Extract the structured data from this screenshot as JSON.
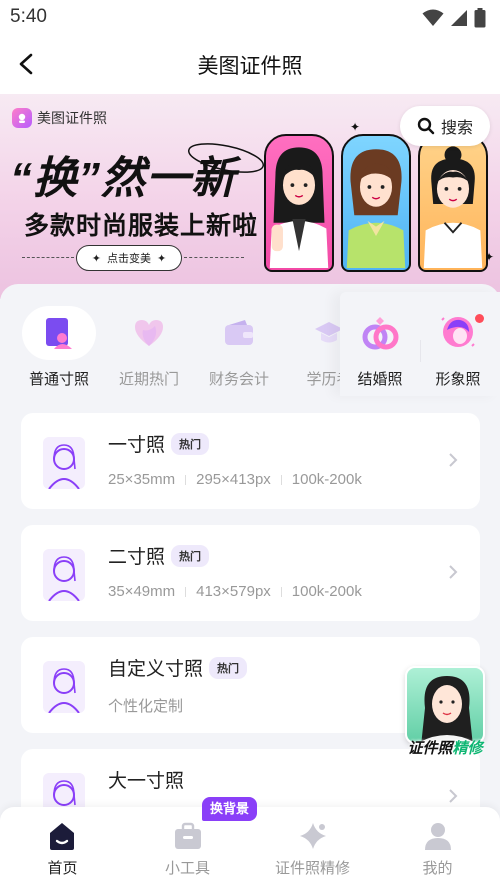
{
  "status_bar": {
    "time": "5:40"
  },
  "nav": {
    "title": "美图证件照"
  },
  "banner": {
    "brand": "美图证件照",
    "headline": "“换”然一新",
    "subheadline": "多款时尚服装上新啦",
    "cta": "点击变美"
  },
  "search": {
    "label": "搜索"
  },
  "categories": [
    {
      "label": "普通寸照",
      "icon": "portrait-card-icon",
      "active": true
    },
    {
      "label": "近期热门",
      "icon": "heart-icon",
      "active": false
    },
    {
      "label": "财务会计",
      "icon": "wallet-icon",
      "active": false
    },
    {
      "label": "学历考",
      "icon": "graduation-cap-icon",
      "active": false
    }
  ],
  "categories_right": [
    {
      "label": "结婚照",
      "icon": "rings-icon"
    },
    {
      "label": "形象照",
      "icon": "profile-icon"
    }
  ],
  "specs": [
    {
      "title": "一寸照",
      "badge": "热门",
      "size_mm": "25×35mm",
      "size_px": "295×413px",
      "file_size": "100k-200k"
    },
    {
      "title": "二寸照",
      "badge": "热门",
      "size_mm": "35×49mm",
      "size_px": "413×579px",
      "file_size": "100k-200k"
    },
    {
      "title": "自定义寸照",
      "badge": "热门",
      "description": "个性化定制"
    },
    {
      "title": "大一寸照"
    }
  ],
  "float_promo": {
    "label_main": "证件照",
    "label_accent": "精修"
  },
  "tab_bar": {
    "tabs": [
      {
        "label": "首页",
        "icon": "home-icon",
        "active": true
      },
      {
        "label": "小工具",
        "icon": "toolbox-icon",
        "active": false
      },
      {
        "label": "证件照精修",
        "icon": "sparkle-star-icon",
        "active": false
      },
      {
        "label": "我的",
        "icon": "user-icon",
        "active": false
      }
    ],
    "tool_badge": "换背景"
  },
  "colors": {
    "accent": "#8a3ff8",
    "primary_purple": "#7b4cf0",
    "promo_green": "#0fb673"
  }
}
